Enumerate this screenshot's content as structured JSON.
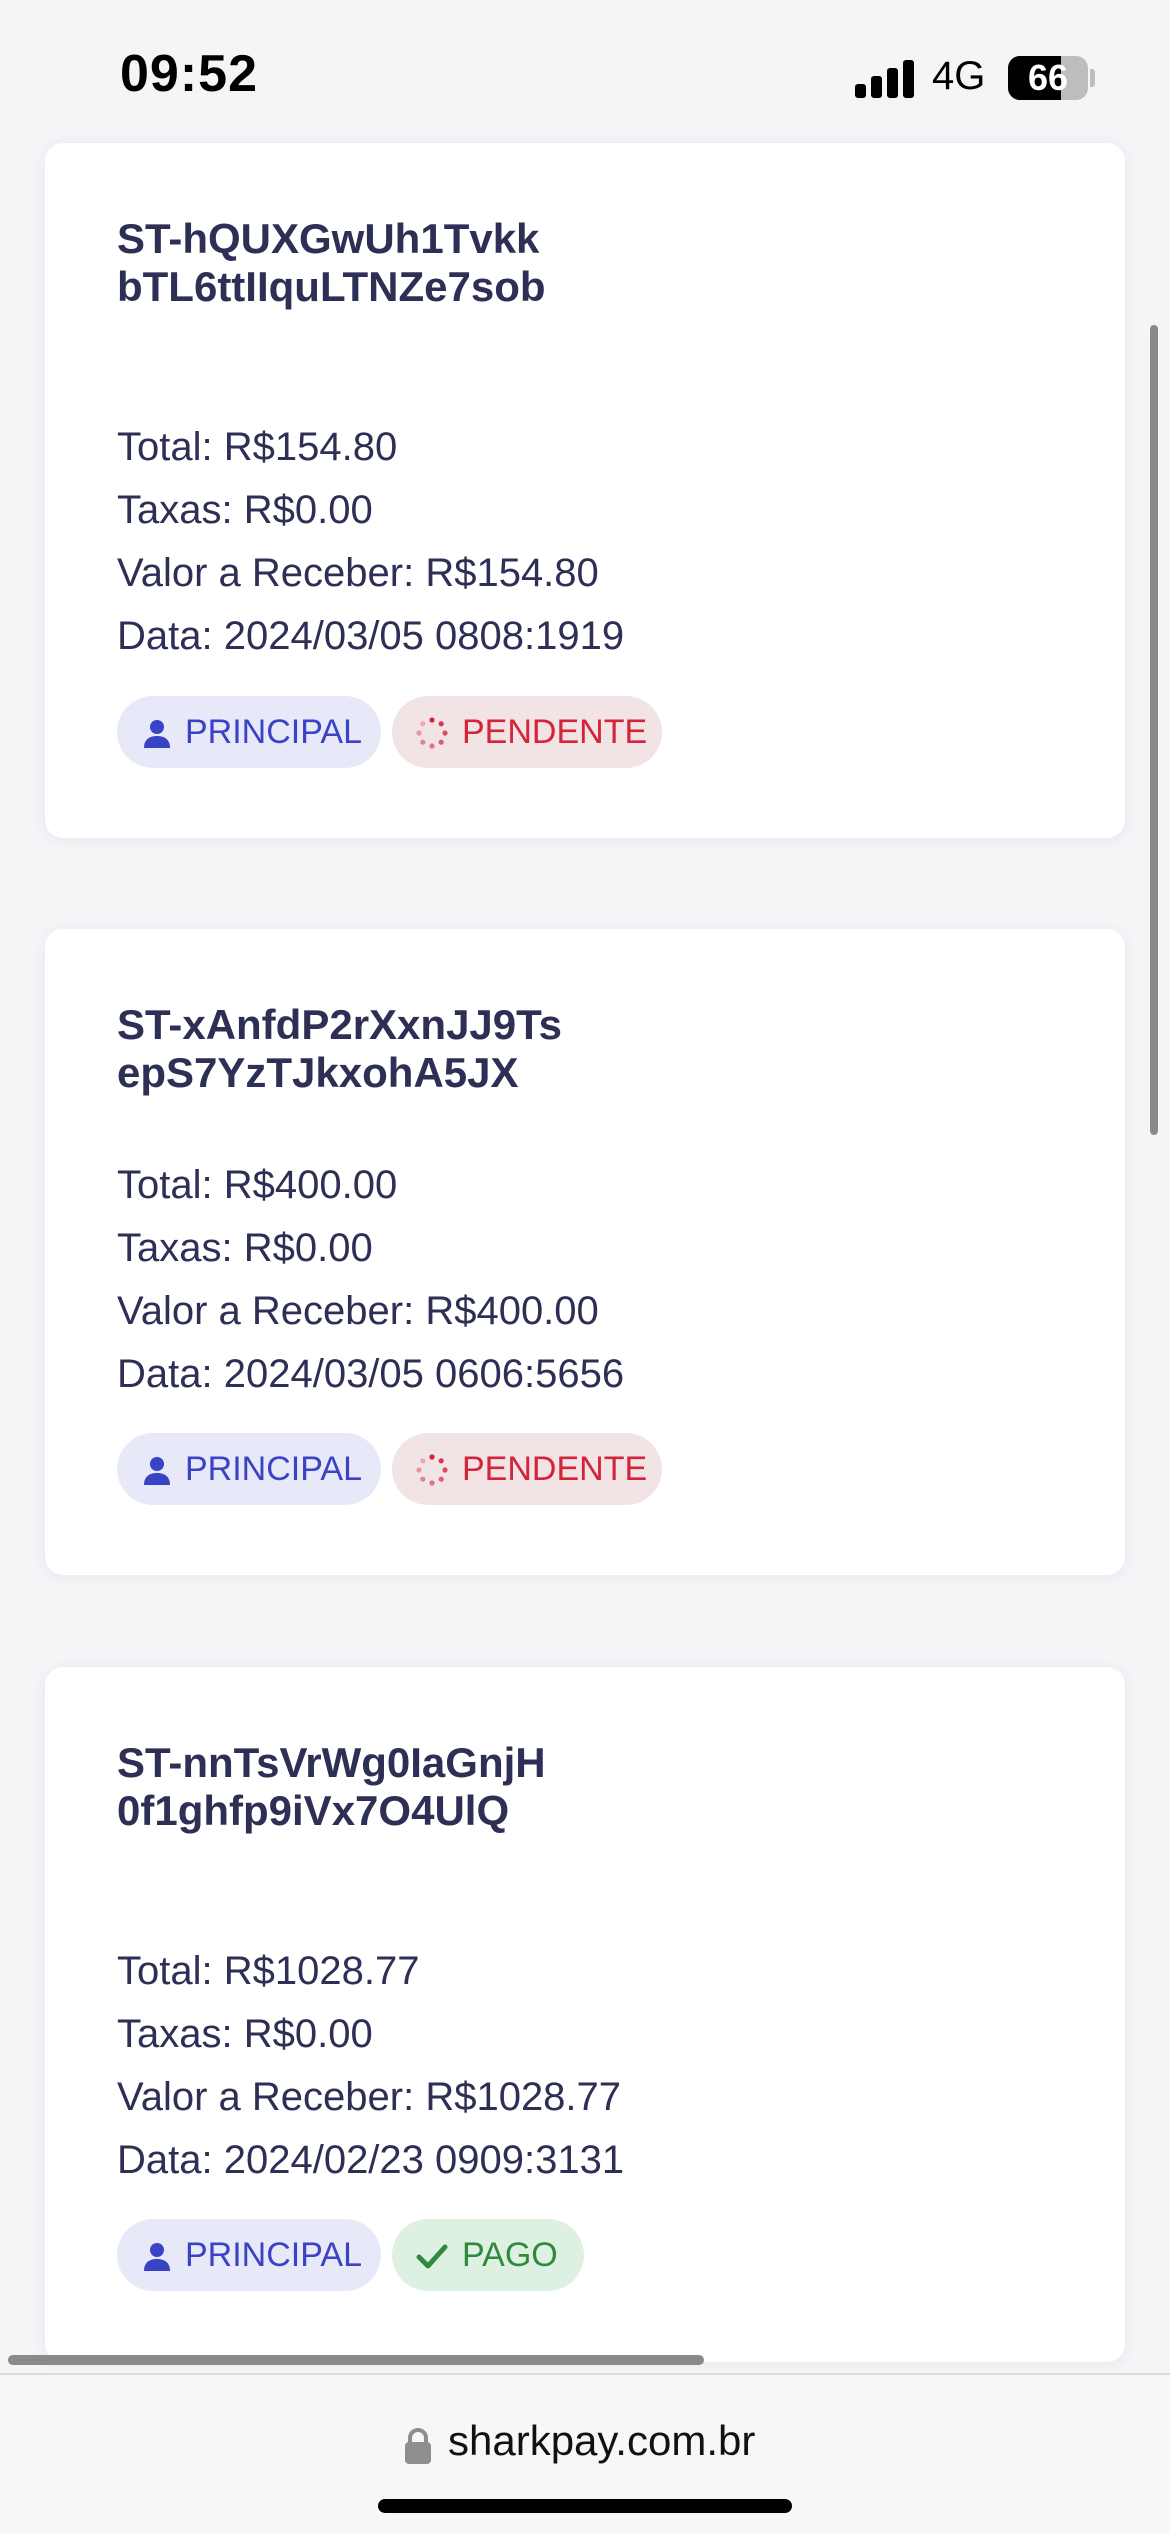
{
  "status_bar": {
    "time": "09:52",
    "network": "4G",
    "battery": "66",
    "battery_level_percent": 66,
    "signal_bars": 4
  },
  "labels": {
    "total": "Total: ",
    "fees": "Taxas: ",
    "receivable": "Valor a Receber: ",
    "date": "Data: "
  },
  "transactions": [
    {
      "id": "ST-hQUXGwUh1TvkkbTL6ttIIquLTNZe7sob",
      "total": "R$154.80",
      "fees": "R$0.00",
      "receivable": "R$154.80",
      "date": "2024/03/05 0808:1919",
      "account": "PRINCIPAL",
      "status": "PENDENTE",
      "status_type": "pending"
    },
    {
      "id": "ST-xAnfdP2rXxnJJ9TsepS7YzTJkxohA5JX",
      "total": "R$400.00",
      "fees": "R$0.00",
      "receivable": "R$400.00",
      "date": "2024/03/05 0606:5656",
      "account": "PRINCIPAL",
      "status": "PENDENTE",
      "status_type": "pending"
    },
    {
      "id": "ST-nnTsVrWg0IaGnjH0f1ghfp9iVx7O4UlQ",
      "total": "R$1028.77",
      "fees": "R$0.00",
      "receivable": "R$1028.77",
      "date": "2024/02/23 0909:3131",
      "account": "PRINCIPAL",
      "status": "PAGO",
      "status_type": "paid"
    }
  ],
  "browser": {
    "url": "sharkpay.com.br"
  },
  "colors": {
    "principal_bg": "#e8e9f8",
    "principal_text": "#3a42c6",
    "pending_bg": "#f2e3e5",
    "pending_text": "#d3243a",
    "paid_bg": "#ddf0e2",
    "paid_text": "#2f8a3c",
    "text": "#2d2f55"
  },
  "icons": {
    "account": "user-icon",
    "pending": "spinner-icon",
    "paid": "checkmark-icon",
    "url": "lock-icon"
  }
}
